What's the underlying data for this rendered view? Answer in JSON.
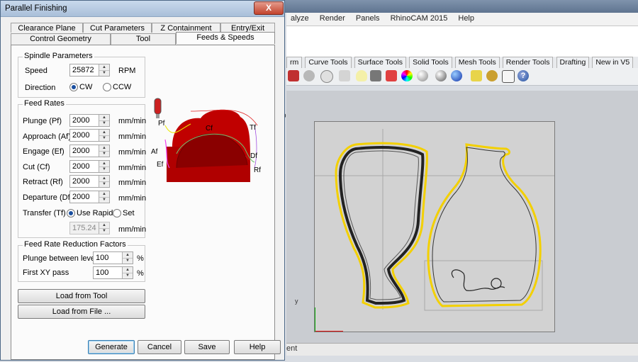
{
  "dialog": {
    "title": "Parallel Finishing",
    "close_label": "X",
    "tabs_row1": [
      "Clearance Plane",
      "Cut Parameters",
      "Z Containment",
      "Entry/Exit"
    ],
    "tabs_row2": [
      "Control Geometry",
      "Tool",
      "Feeds & Speeds"
    ],
    "active_tab": "Feeds & Speeds",
    "spindle": {
      "group_title": "Spindle Parameters",
      "speed_label": "Speed",
      "speed_value": "25872",
      "speed_unit": "RPM",
      "direction_label": "Direction",
      "cw_label": "CW",
      "ccw_label": "CCW",
      "direction_selected": "CW"
    },
    "feed_rates": {
      "group_title": "Feed Rates",
      "rows": [
        {
          "label": "Plunge (Pf)",
          "value": "2000",
          "unit": "mm/min"
        },
        {
          "label": "Approach (Af)",
          "value": "2000",
          "unit": "mm/min"
        },
        {
          "label": "Engage (Ef)",
          "value": "2000",
          "unit": "mm/min"
        },
        {
          "label": "Cut (Cf)",
          "value": "2000",
          "unit": "mm/min"
        },
        {
          "label": "Retract (Rf)",
          "value": "2000",
          "unit": "mm/min"
        },
        {
          "label": "Departure  (Df)",
          "value": "2000",
          "unit": "mm/min"
        }
      ],
      "transfer_label": "Transfer (Tf)",
      "use_rapid_label": "Use Rapid",
      "set_label": "Set",
      "transfer_selected": "Use Rapid",
      "transfer_value": "175.24",
      "transfer_unit": "mm/min"
    },
    "diagram": {
      "labels": {
        "pf": "Pf",
        "cf": "Cf",
        "tf": "Tf",
        "af": "Af",
        "df": "Df",
        "ef": "Ef",
        "rf": "Rf"
      }
    },
    "reduction": {
      "group_title": "Feed Rate Reduction Factors",
      "plunge_label": "Plunge between levels",
      "plunge_value": "100",
      "first_xy_label": "First XY pass",
      "first_xy_value": "100",
      "unit": "%"
    },
    "buttons": {
      "load_from_tool": "Load from Tool",
      "load_from_file": "Load from File ...",
      "generate": "Generate",
      "cancel": "Cancel",
      "save": "Save",
      "help": "Help"
    }
  },
  "background_app": {
    "menu": [
      "alyze",
      "Render",
      "Panels",
      "RhinoCAM 2015",
      "Help"
    ],
    "tabs": [
      "rm",
      "Curve Tools",
      "Surface Tools",
      "Solid Tools",
      "Mesh Tools",
      "Render Tools",
      "Drafting",
      "New in V5"
    ],
    "viewport_label": "p",
    "bottom_text": "ent",
    "axis_label": "y"
  }
}
